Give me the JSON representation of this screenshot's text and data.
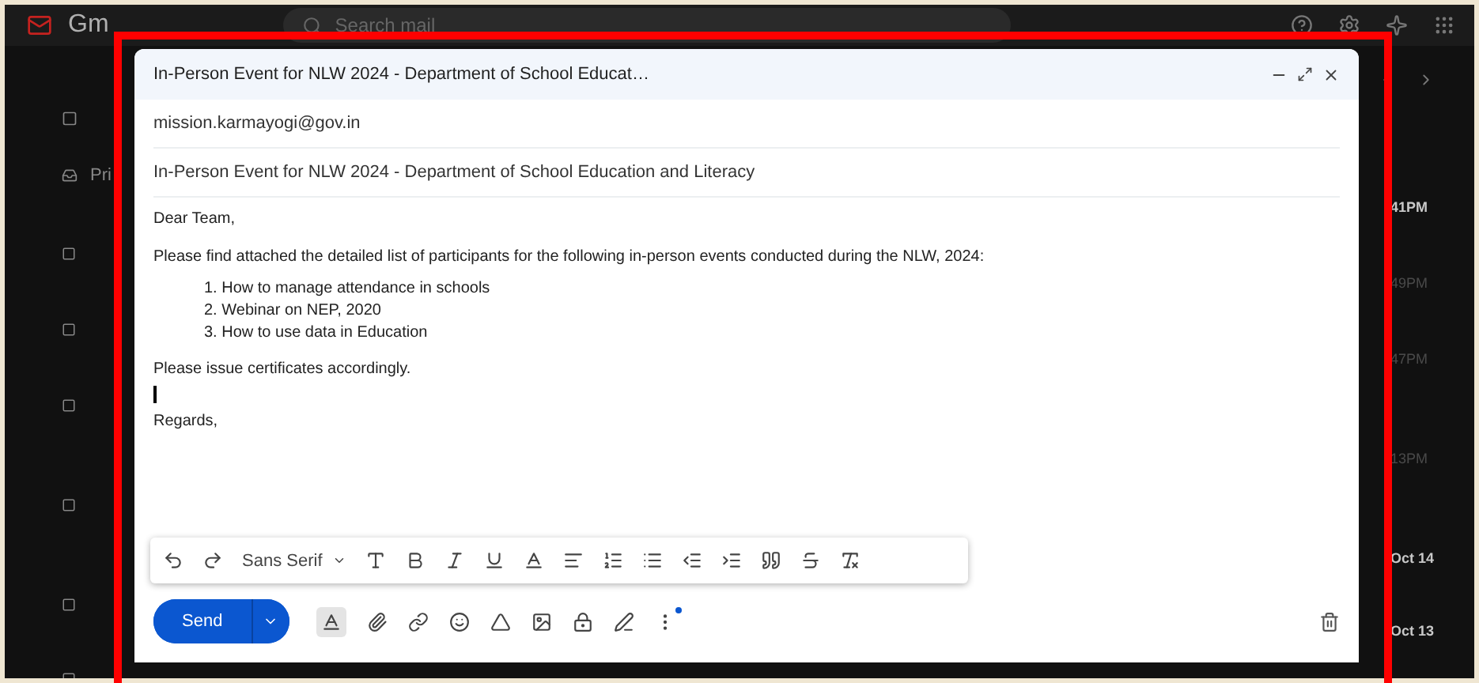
{
  "app": {
    "logo": "Gm",
    "search": {
      "placeholder": "Search mail"
    },
    "tab_partial": "Pri"
  },
  "compose": {
    "title": "In-Person Event for NLW 2024 - Department of School Educat…",
    "recipient": "mission.karmayogi@gov.in",
    "subject": "In-Person Event for NLW 2024 - Department of School Education and Literacy",
    "body": {
      "greeting": "Dear Team,",
      "intro": "Please find attached the detailed list of participants for the following in-person events conducted during the NLW, 2024:",
      "list": [
        {
          "number": "1.",
          "text": "How to manage attendance in schools"
        },
        {
          "number": "2.",
          "text": "Webinar on NEP, 2020"
        },
        {
          "number": "3.",
          "text": "How to use data in Education"
        }
      ],
      "closing": "Please issue certificates accordingly.",
      "signoff": "Regards,"
    },
    "toolbar": {
      "font": "Sans Serif"
    },
    "send_label": "Send"
  },
  "inbox_times": [
    {
      "text": "41PM",
      "unread": true
    },
    {
      "text": "49PM",
      "unread": false
    },
    {
      "text": "47PM",
      "unread": false
    },
    {
      "text": "13PM",
      "unread": false
    },
    {
      "text": "Oct 14",
      "unread": true
    },
    {
      "text": "Oct 13",
      "unread": true
    }
  ]
}
